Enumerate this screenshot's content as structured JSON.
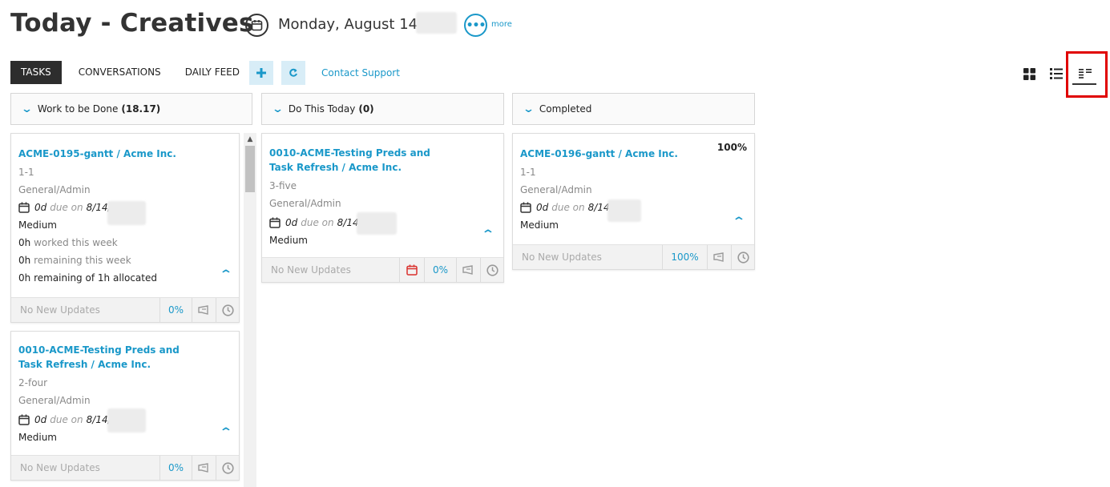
{
  "header": {
    "title": "Today - Creatives",
    "date_text": "Monday, August 14,",
    "more_label": "more",
    "more_glyph": "•••"
  },
  "tabs": [
    {
      "label": "TASKS",
      "active": true
    },
    {
      "label": "CONVERSATIONS",
      "active": false
    },
    {
      "label": "DAILY FEED",
      "active": false
    }
  ],
  "toolbar": {
    "add_icon": "+",
    "refresh_icon": "refresh-icon",
    "support_label": "Contact Support"
  },
  "view_modes": [
    "grid-view-icon",
    "list-view-icon",
    "board-view-icon"
  ],
  "columns": [
    {
      "label": "Work to be Done",
      "count": "(18.17)",
      "cards": [
        {
          "title": "ACME-0195-gantt / Acme Inc.",
          "sub": "1-1",
          "category": "General/Admin",
          "duration": "0d",
          "due_label": "due on",
          "due_date": "8/14/",
          "priority": "Medium",
          "worked_value": "0h",
          "worked_label": "worked this week",
          "remaining_value": "0h",
          "remaining_label": "remaining this week",
          "remaining_of_value": "0h",
          "remaining_of_label": "remaining of",
          "allocated_value": "1h",
          "allocated_label": "allocated",
          "updates": "No New Updates",
          "percent": "0%"
        },
        {
          "title": "0010-ACME-Testing Preds and Task Refresh / Acme Inc.",
          "sub": "2-four",
          "category": "General/Admin",
          "duration": "0d",
          "due_label": "due on",
          "due_date": "8/14/",
          "priority": "Medium",
          "updates": "No New Updates",
          "percent": "0%"
        }
      ]
    },
    {
      "label": "Do This Today",
      "count": "(0)",
      "cards": [
        {
          "title": "0010-ACME-Testing Preds and Task Refresh / Acme Inc.",
          "sub": "3-five",
          "category": "General/Admin",
          "duration": "0d",
          "due_label": "due on",
          "due_date": "8/14/",
          "priority": "Medium",
          "updates": "No New Updates",
          "percent": "0%"
        }
      ]
    },
    {
      "label": "Completed",
      "count": "",
      "cards": [
        {
          "title": "ACME-0196-gantt / Acme Inc.",
          "sub": "1-1",
          "category": "General/Admin",
          "duration": "0d",
          "due_label": "due on",
          "due_date": "8/14/",
          "priority": "Medium",
          "progress": "100%",
          "updates": "No New Updates",
          "percent": "100%"
        }
      ]
    }
  ],
  "colors": {
    "accent": "#1a98c9",
    "active_tab": "#2d2d2d",
    "highlight": "#e00000",
    "overdue": "#d9302c"
  }
}
